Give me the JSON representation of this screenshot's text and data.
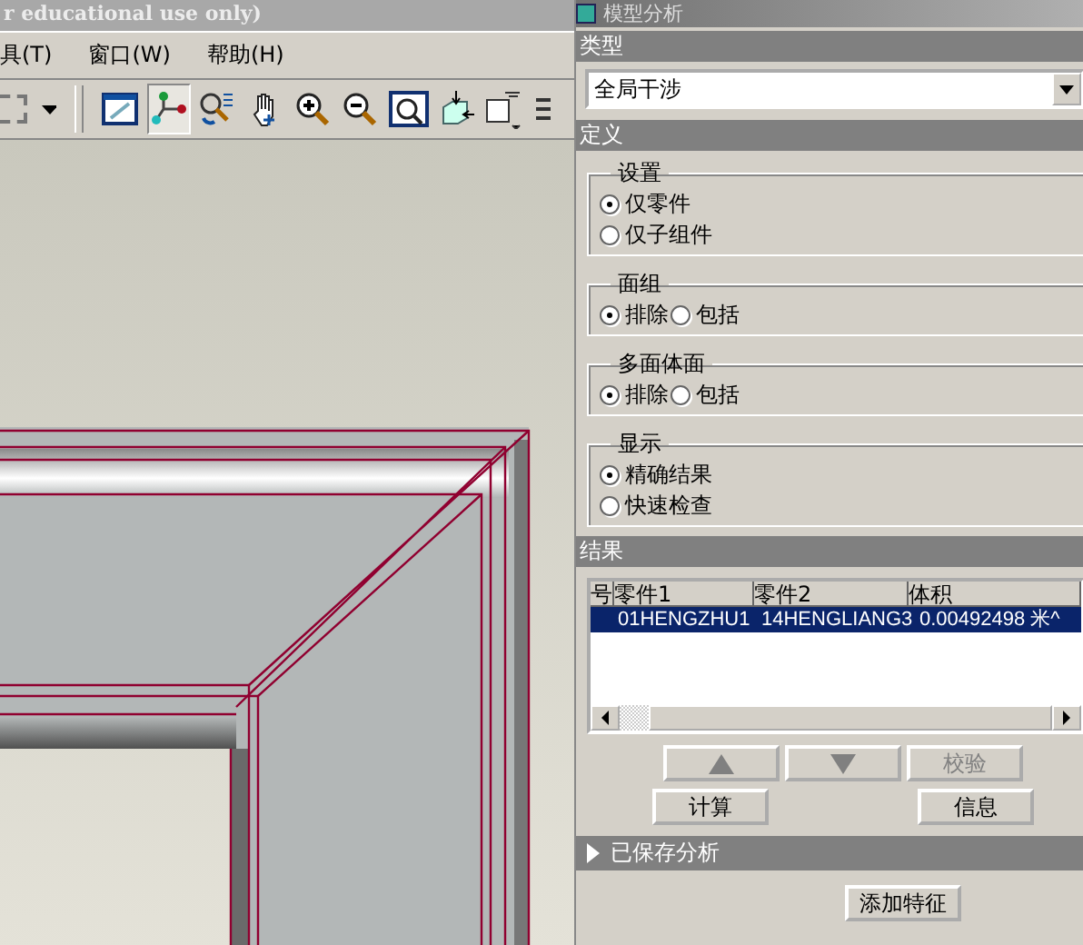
{
  "app_title": "r educational use only)",
  "menu": [
    "具(T)",
    "窗口(W)",
    "帮助(H)"
  ],
  "toolbar": {
    "tools": [
      {
        "kind": "window",
        "selected": false
      },
      {
        "kind": "node",
        "selected": true
      },
      {
        "kind": "spin",
        "selected": false
      },
      {
        "kind": "pan",
        "selected": false
      },
      {
        "kind": "zoomin",
        "selected": false
      },
      {
        "kind": "zoomout",
        "selected": false
      },
      {
        "kind": "zoomwin",
        "selected": false
      },
      {
        "kind": "cube",
        "selected": false
      },
      {
        "kind": "textbox",
        "selected": false
      },
      {
        "kind": "layers",
        "selected": false
      }
    ]
  },
  "panel": {
    "title": "模型分析",
    "type_header": "类型",
    "type_value": "全局干涉",
    "definition_header": "定义",
    "groups": [
      {
        "title": "设置",
        "kind": "stacked",
        "options": [
          {
            "label": "仅零件",
            "selected": true
          },
          {
            "label": "仅子组件",
            "selected": false
          }
        ]
      },
      {
        "title": "面组",
        "kind": "inline",
        "options": [
          {
            "label": "排除",
            "selected": true
          },
          {
            "label": "包括",
            "selected": false
          }
        ]
      },
      {
        "title": "多面体面",
        "kind": "inline",
        "options": [
          {
            "label": "排除",
            "selected": true
          },
          {
            "label": "包括",
            "selected": false
          }
        ]
      },
      {
        "title": "显示",
        "kind": "stacked",
        "options": [
          {
            "label": "精确结果",
            "selected": true
          },
          {
            "label": "快速检查",
            "selected": false
          }
        ]
      }
    ],
    "results_header": "结果",
    "table": {
      "columns": [
        "号",
        "零件1",
        "零件2",
        "体积"
      ],
      "rows": [
        {
          "cells": [
            "",
            "01HENGZHU1",
            "14HENGLIANG3",
            "0.00492498 米^"
          ],
          "selected": true
        }
      ]
    },
    "nav_buttons": [
      {
        "kind": "up",
        "disabled": true
      },
      {
        "kind": "down",
        "disabled": true
      },
      {
        "kind": "text",
        "label": "校验",
        "disabled": true
      }
    ],
    "action_buttons": [
      "计算",
      "信息"
    ],
    "saved_header": {
      "label": "已保存分析",
      "expanded": false
    },
    "add_feature": "添加特征"
  }
}
